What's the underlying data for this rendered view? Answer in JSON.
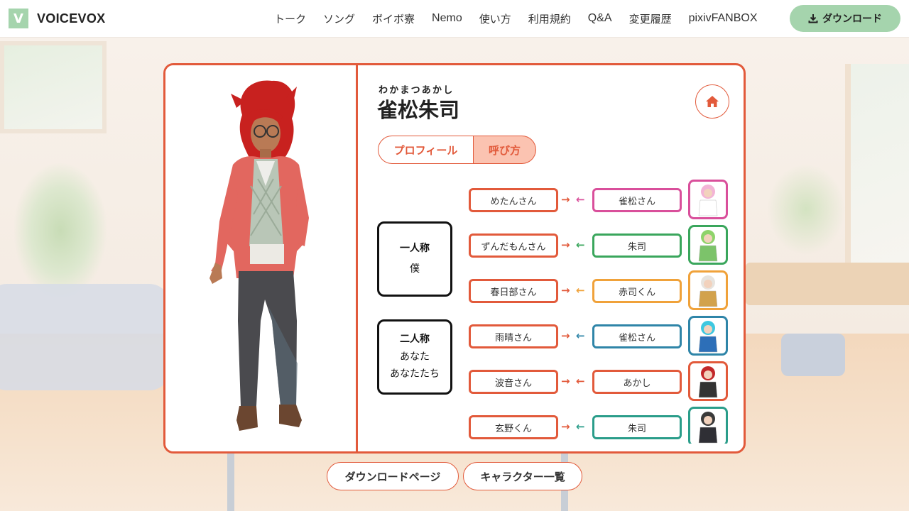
{
  "brand": {
    "logo_letter": "V",
    "name": "VOICEVOX"
  },
  "nav": {
    "links": [
      "トーク",
      "ソング",
      "ボイボ寮",
      "Nemo",
      "使い方",
      "利用規約",
      "Q&A",
      "変更履歴",
      "pixivFANBOX"
    ],
    "download_label": "ダウンロード"
  },
  "character": {
    "ruby": "わかまつあかし",
    "name": "雀松朱司"
  },
  "tabs": {
    "profile": "プロフィール",
    "call": "呼び方",
    "active": "呼び方"
  },
  "first_person": {
    "label": "一人称",
    "values": [
      "僕"
    ]
  },
  "second_person": {
    "label": "二人称",
    "values": [
      "あなた",
      "あなたたち"
    ]
  },
  "calls": [
    {
      "calls_them": "めたんさん",
      "called_by": "雀松さん",
      "color": "#d94f9b"
    },
    {
      "calls_them": "ずんだもんさん",
      "called_by": "朱司",
      "color": "#3aa65c"
    },
    {
      "calls_them": "春日部さん",
      "called_by": "赤司くん",
      "color": "#f0a23a"
    },
    {
      "calls_them": "雨晴さん",
      "called_by": "雀松さん",
      "color": "#2f85a8"
    },
    {
      "calls_them": "波音さん",
      "called_by": "あかし",
      "color": "#e25a3b"
    },
    {
      "calls_them": "玄野くん",
      "called_by": "朱司",
      "color": "#2a9d8a"
    }
  ],
  "bottom_buttons": {
    "download_page": "ダウンロードページ",
    "character_list": "キャラクター一覧"
  },
  "accent_color": "#e25a3b",
  "brand_green": "#a5d4ad"
}
